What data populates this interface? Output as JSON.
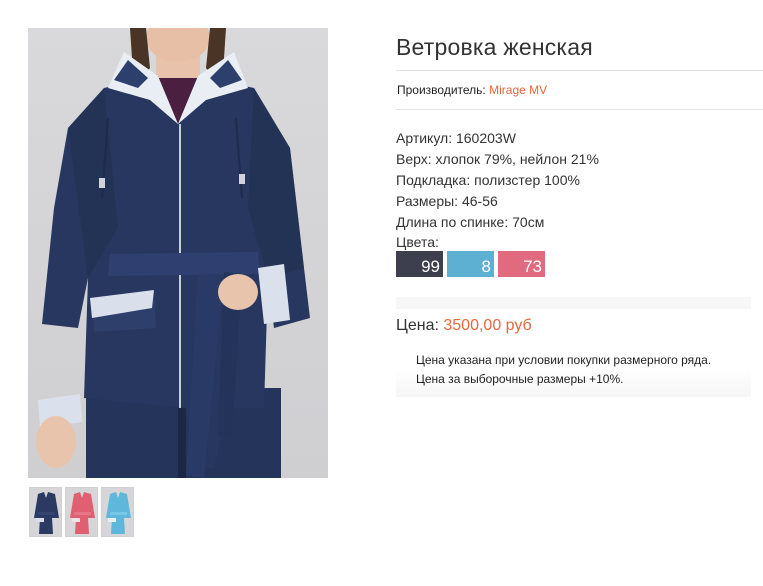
{
  "product": {
    "title": "Ветровка женская",
    "maker_label": "Производитель:",
    "maker_name": "Mirage MV",
    "specs": [
      "Артикул: 160203W",
      "Верх: хлопок 79%, нейлон 21%",
      "Подкладка: полизстер 100%",
      "Размеры: 46-56",
      "Длина по спинке: 70см"
    ],
    "colors_label": "Цвета:",
    "colors": [
      {
        "code": "99",
        "hex": "#3d3f4f"
      },
      {
        "code": "8",
        "hex": "#5db0d2"
      },
      {
        "code": "73",
        "hex": "#e06a7e"
      }
    ],
    "price_label": "Цена:",
    "price_value": "3500,00 руб",
    "note_lines": [
      "Цена указана при условии покупки размерного ряда.",
      "Цена за выборочные размеры +10%."
    ]
  },
  "gallery": {
    "main_color": "#27375f",
    "thumbs": [
      {
        "name": "navy",
        "hex": "#2b3a63"
      },
      {
        "name": "pink",
        "hex": "#e06072"
      },
      {
        "name": "blue",
        "hex": "#5fb8dc"
      }
    ]
  }
}
